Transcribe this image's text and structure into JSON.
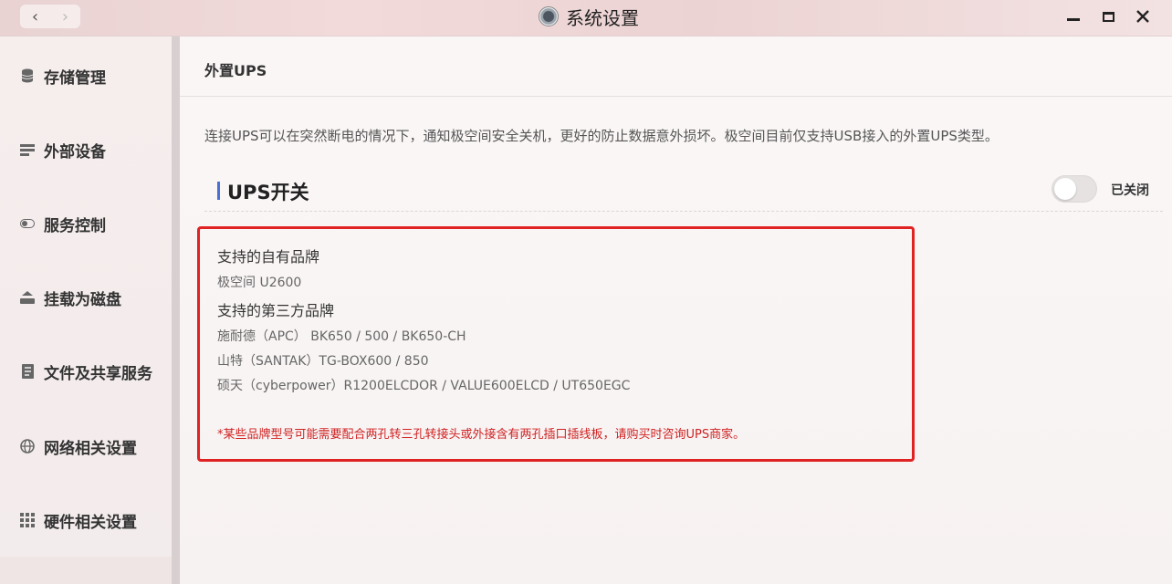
{
  "window": {
    "title": "系统设置",
    "back_icon": "‹",
    "forward_icon": "›"
  },
  "sidebar": {
    "items": [
      {
        "label": "存储管理",
        "icon": "database-icon"
      },
      {
        "label": "外部设备",
        "icon": "device-icon"
      },
      {
        "label": "服务控制",
        "icon": "toggle-icon"
      },
      {
        "label": "挂载为磁盘",
        "icon": "disk-mount-icon"
      },
      {
        "label": "文件及共享服务",
        "icon": "file-share-icon"
      },
      {
        "label": "网络相关设置",
        "icon": "globe-icon"
      },
      {
        "label": "硬件相关设置",
        "icon": "grid-icon"
      }
    ]
  },
  "main": {
    "page_title": "外置UPS",
    "description": "连接UPS可以在突然断电的情况下，通知极空间安全关机，更好的防止数据意外损坏。极空间目前仅支持USB接入的外置UPS类型。",
    "section_title": "UPS开关",
    "toggle_label": "已关闭",
    "toggle_on": false,
    "brands": {
      "own_heading": "支持的自有品牌",
      "own_items": [
        "极空间 U2600"
      ],
      "third_heading": "支持的第三方品牌",
      "third_items": [
        "施耐德（APC） BK650 / 500 / BK650-CH",
        "山特（SANTAK）TG-BOX600 / 850",
        "硕天（cyberpower）R1200ELCDOR / VALUE600ELCD / UT650EGC"
      ],
      "note": "*某些品牌型号可能需要配合两孔转三孔转接头或外接含有两孔插口插线板，请购买时咨询UPS商家。"
    }
  },
  "colors": {
    "accent": "#4a6fd6",
    "highlight_border": "#e02222",
    "note_text": "#d02222"
  }
}
